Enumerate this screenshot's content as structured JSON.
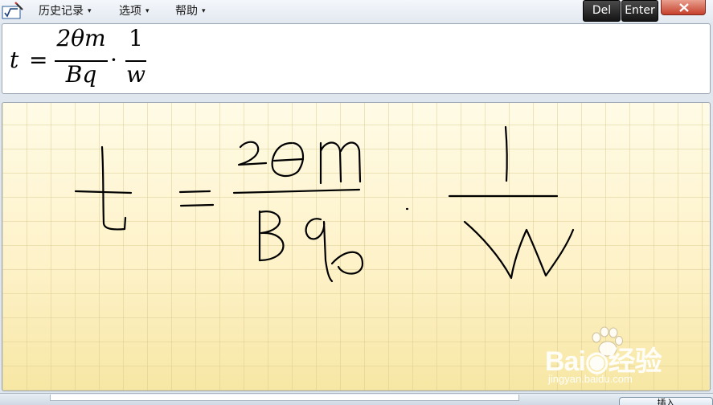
{
  "menubar": {
    "items": [
      "历史记录",
      "选项",
      "帮助"
    ],
    "caret": "▾"
  },
  "keys": {
    "del": "Del",
    "enter": "Enter"
  },
  "result": {
    "lhs": "t",
    "equals": "=",
    "frac1_num": "2θm",
    "frac1_den": "Bq",
    "dot": "·",
    "frac2_num": "1",
    "frac2_den": "w"
  },
  "watermark": {
    "brand": "Bai◉经验",
    "url": "jingyan.baidu.com"
  },
  "bottom": {
    "insert_label": "插入"
  },
  "colors": {
    "pad_top": "#fffbe6",
    "pad_bottom": "#f7e7a4",
    "ink": "#000000",
    "key_bg": "#1e1e1e",
    "close_btn": "#c6402b"
  }
}
